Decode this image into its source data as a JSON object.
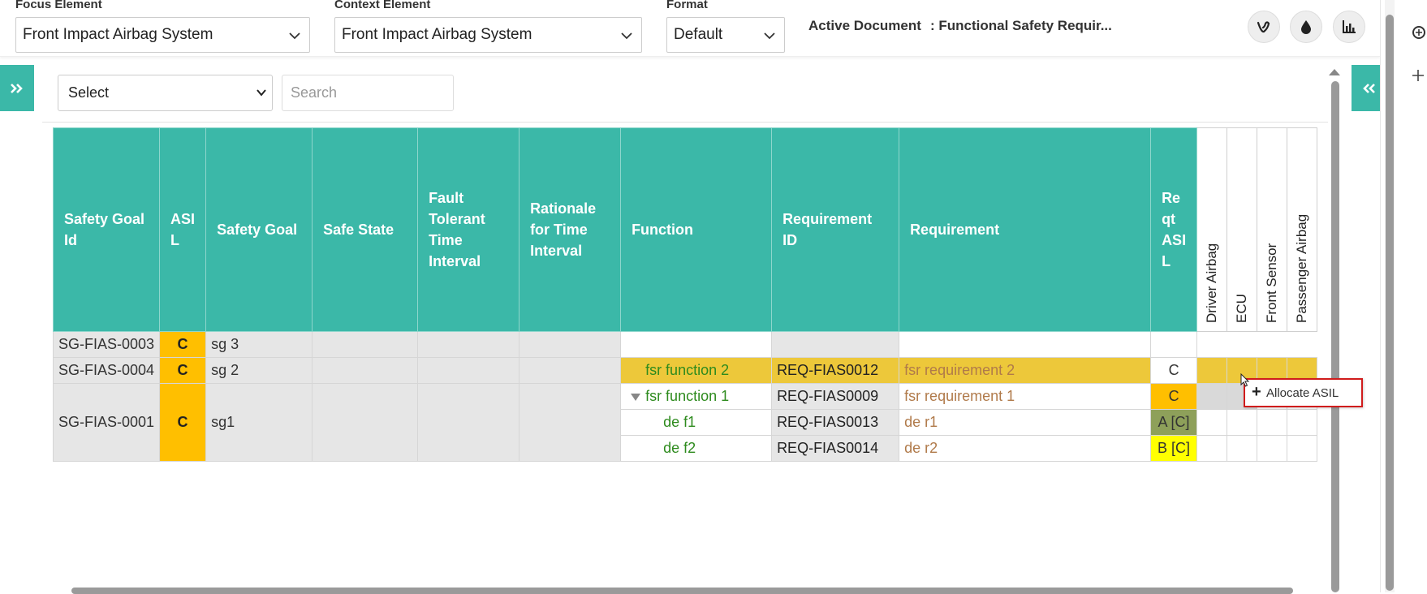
{
  "topbar": {
    "focus_label": "Focus Element",
    "focus_value": "Front Impact Airbag System",
    "context_label": "Context Element",
    "context_value": "Front Impact Airbag System",
    "format_label": "Format",
    "format_value": "Default",
    "active_doc_label": "Active Document",
    "active_doc_value": ": Functional Safety Requir..."
  },
  "toolbar_icons": [
    "vine-icon",
    "drop-icon",
    "bar-chart-icon"
  ],
  "filter": {
    "select_label": "Select",
    "search_placeholder": "Search"
  },
  "table": {
    "headers": {
      "sg_id": "Safety Goal Id",
      "asil": "ASI L",
      "safety_goal": "Safety Goal",
      "safe_state": "Safe State",
      "ftti": "Fault Tolerant Time Interval",
      "rationale": "Rationale for Time Interval",
      "function": "Function",
      "req_id": "Requirement ID",
      "requirement": "Requirement",
      "req_asil": "Re qt ASI L",
      "alloc": [
        "Driver Airbag",
        "ECU",
        "Front Sensor",
        "Passenger Airbag"
      ]
    },
    "rows": [
      {
        "sg_id": "SG-FIAS-0003",
        "asil": "C",
        "safety_goal": "sg 3",
        "function": "",
        "req_id": "",
        "requirement": "",
        "req_asil": ""
      },
      {
        "sg_id": "SG-FIAS-0004",
        "asil": "C",
        "safety_goal": "sg 2",
        "function": "fsr function 2",
        "req_id": "REQ-FIAS0012",
        "requirement": "fsr requirement 2",
        "req_asil": "C"
      },
      {
        "sg_id": "SG-FIAS-0001",
        "asil": "C",
        "safety_goal": "sg1",
        "function": "fsr function 1",
        "req_id": "REQ-FIAS0009",
        "requirement": "fsr requirement 1",
        "req_asil": "C"
      },
      {
        "function": "de f1",
        "req_id": "REQ-FIAS0013",
        "requirement": "de r1",
        "req_asil": "A [C]"
      },
      {
        "function": "de f2",
        "req_id": "REQ-FIAS0014",
        "requirement": "de r2",
        "req_asil": "B [C]"
      }
    ]
  },
  "context_menu": {
    "item": "Allocate ASIL"
  },
  "colors": {
    "header": "#3bb8a8",
    "asil": "#ffbf00",
    "selected_row": "#edc83a",
    "menu_border": "#d01c1c"
  }
}
